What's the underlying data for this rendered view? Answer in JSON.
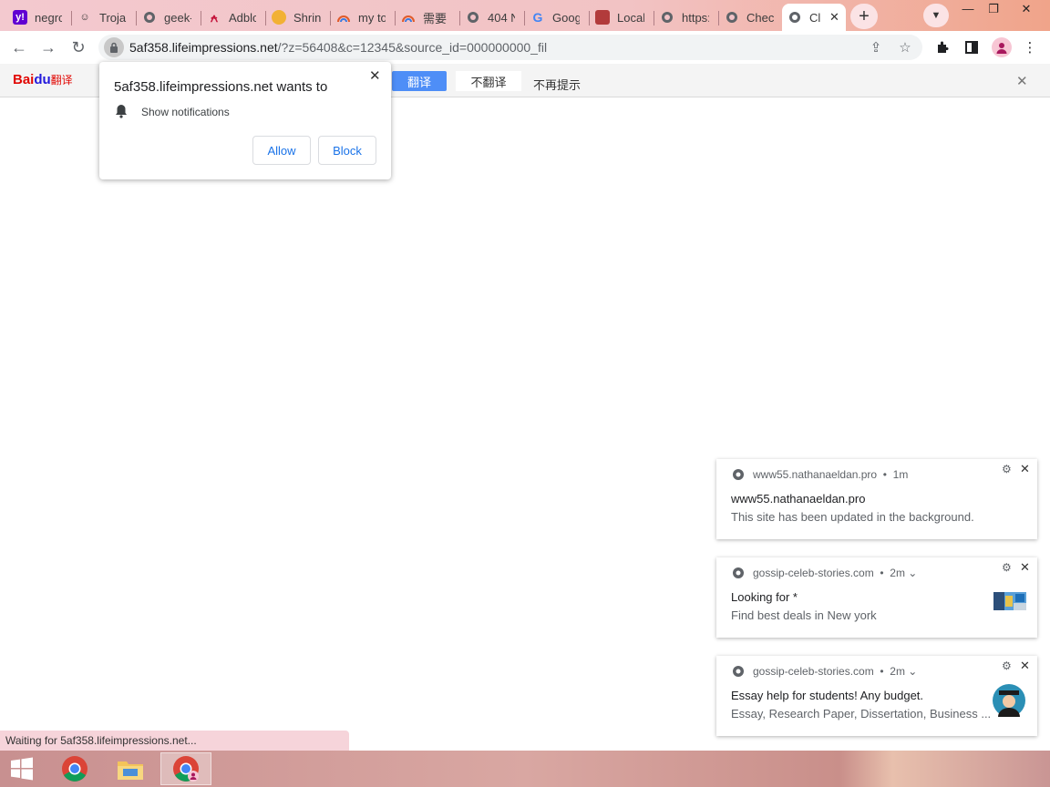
{
  "browser": {
    "tabs": [
      {
        "title": "negro",
        "favicon": "yahoo-icon",
        "color": "#6001d2"
      },
      {
        "title": "Trojan",
        "favicon": "smiley-icon",
        "color": "#444444"
      },
      {
        "title": "geek-",
        "favicon": "globe-icon",
        "color": "#5f6368"
      },
      {
        "title": "Adblo",
        "favicon": "adblock-icon",
        "color": "#c4133a"
      },
      {
        "title": "Shrinl",
        "favicon": "bee-icon",
        "color": "#f2b134"
      },
      {
        "title": "my to",
        "favicon": "rainbow-icon",
        "color": "#e05a2a"
      },
      {
        "title": "需要",
        "favicon": "rainbow-icon",
        "color": "#e05a2a"
      },
      {
        "title": "404 N",
        "favicon": "globe-icon",
        "color": "#5f6368"
      },
      {
        "title": "Goog",
        "favicon": "google-icon",
        "color": "#4285f4"
      },
      {
        "title": "Local",
        "favicon": "gift-icon",
        "color": "#b23b3b"
      },
      {
        "title": "https:",
        "favicon": "globe-icon",
        "color": "#5f6368"
      },
      {
        "title": "Checl",
        "favicon": "globe-icon",
        "color": "#5f6368"
      },
      {
        "title": "Cl",
        "favicon": "globe-icon",
        "color": "#5f6368",
        "active": true
      }
    ],
    "address": {
      "host": "5af358.lifeimpressions.net",
      "rest": "/?z=56408&c=12345&source_id=000000000_fil"
    }
  },
  "translate_bar": {
    "logo_bai": "Bai",
    "logo_du": "du",
    "logo_fanyi": "翻译",
    "translate_label": "翻译",
    "no_translate_label": "不翻译",
    "never_label": "不再提示"
  },
  "permission": {
    "title": "5af358.lifeimpressions.net wants to",
    "request": "Show notifications",
    "allow_label": "Allow",
    "block_label": "Block"
  },
  "notifications": [
    {
      "source": "www55.nathanaeldan.pro",
      "time": "1m",
      "title": "www55.nathanaeldan.pro",
      "body": "This site has been updated in the background.",
      "has_image": false,
      "has_chevron": false
    },
    {
      "source": "gossip-celeb-stories.com",
      "time": "2m",
      "title": "Looking for *",
      "body": "Find best deals in New york",
      "has_image": true,
      "has_chevron": true
    },
    {
      "source": "gossip-celeb-stories.com",
      "time": "2m",
      "title": "Essay help for students! Any budget.",
      "body": "Essay, Research Paper, Dissertation, Business ...",
      "has_image": true,
      "has_chevron": true
    }
  ],
  "status_text": "Waiting for 5af358.lifeimpressions.net...",
  "taskbar": {
    "items": [
      "windows-start-icon",
      "chrome-icon",
      "file-explorer-icon",
      "chrome-profile-icon"
    ]
  }
}
